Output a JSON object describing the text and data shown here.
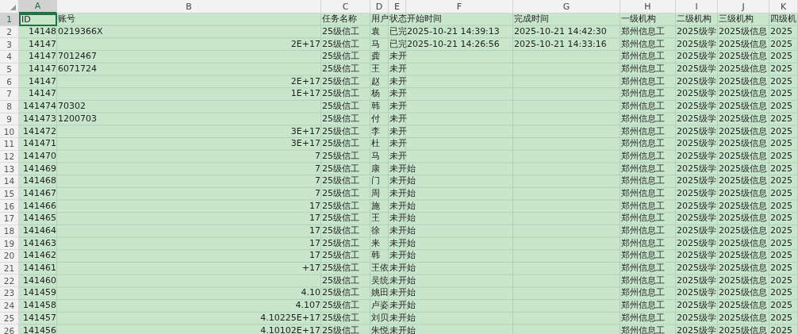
{
  "columns": [
    {
      "letter": "A",
      "selected": true
    },
    {
      "letter": "B",
      "selected": false
    },
    {
      "letter": "C",
      "selected": false
    },
    {
      "letter": "D",
      "selected": false
    },
    {
      "letter": "E",
      "selected": false
    },
    {
      "letter": "F",
      "selected": false
    },
    {
      "letter": "G",
      "selected": false
    },
    {
      "letter": "H",
      "selected": false
    },
    {
      "letter": "I",
      "selected": false
    },
    {
      "letter": "J",
      "selected": false
    },
    {
      "letter": "K",
      "selected": false
    }
  ],
  "rows": [
    {
      "number": "1",
      "selected": true,
      "cells": {
        "A": "ID",
        "B": {
          "text": "账号",
          "kind": "text"
        },
        "C": "任务名称",
        "D": "用户",
        "E": "状态",
        "F": "开始时间",
        "G": "完成时间",
        "H": "一级机构",
        "I": "二级机构",
        "J": "三级机构",
        "K": "四级机"
      }
    },
    {
      "number": "2",
      "selected": false,
      "cells": {
        "A": "14148",
        "B": {
          "text": "0219366X",
          "kind": "text"
        },
        "C": "25级信工",
        "D": "袁",
        "E": "已完",
        "F": "2025-10-21 14:39:13",
        "G": "2025-10-21 14:42:30",
        "H": "郑州信息工",
        "I": "2025级学",
        "J": "2025级信息",
        "K": "2025"
      }
    },
    {
      "number": "3",
      "selected": false,
      "cells": {
        "A": "14147",
        "B": {
          "text": "2E+17",
          "kind": "number"
        },
        "C": "25级信工",
        "D": "马",
        "E": "已完",
        "F": "2025-10-21 14:26:56",
        "G": "2025-10-21 14:33:16",
        "H": "郑州信息工",
        "I": "2025级学",
        "J": "2025级信息",
        "K": "2025"
      }
    },
    {
      "number": "4",
      "selected": false,
      "cells": {
        "A": "14147",
        "B": {
          "text": "7012467",
          "kind": "text"
        },
        "C": "25级信工",
        "D": "龚",
        "E": "未开",
        "H": "郑州信息工",
        "I": "2025级学",
        "J": "2025级信息",
        "K": "2025"
      }
    },
    {
      "number": "5",
      "selected": false,
      "cells": {
        "A": "14147",
        "B": {
          "text": "6071724",
          "kind": "text"
        },
        "C": "25级信工",
        "D": "王",
        "E": "未开",
        "H": "郑州信息工",
        "I": "2025级学",
        "J": "2025级信息",
        "K": "2025"
      }
    },
    {
      "number": "6",
      "selected": false,
      "cells": {
        "A": "14147",
        "B": {
          "text": "2E+17",
          "kind": "number"
        },
        "C": "25级信工",
        "D": "赵",
        "E": "未开",
        "H": "郑州信息工",
        "I": "2025级学",
        "J": "2025级信息",
        "K": "2025"
      }
    },
    {
      "number": "7",
      "selected": false,
      "cells": {
        "A": "14147",
        "B": {
          "text": "1E+17",
          "kind": "number"
        },
        "C": "25级信工",
        "D": "杨",
        "E": "未开",
        "H": "郑州信息工",
        "I": "2025级学",
        "J": "2025级信息",
        "K": "2025"
      }
    },
    {
      "number": "8",
      "selected": false,
      "cells": {
        "A": "141474",
        "B": {
          "text": "70302",
          "kind": "text"
        },
        "C": "25级信工",
        "D": "韩",
        "E": "未开",
        "H": "郑州信息工",
        "I": "2025级学",
        "J": "2025级信息",
        "K": "2025"
      }
    },
    {
      "number": "9",
      "selected": false,
      "cells": {
        "A": "141473",
        "B": {
          "text": "1200703",
          "kind": "text"
        },
        "C": "25级信工",
        "D": "付",
        "E": "未开",
        "H": "郑州信息工",
        "I": "2025级学",
        "J": "2025级信息",
        "K": "2025"
      }
    },
    {
      "number": "10",
      "selected": false,
      "cells": {
        "A": "141472",
        "B": {
          "text": "3E+17",
          "kind": "number"
        },
        "C": "25级信工",
        "D": "李",
        "E": "未开",
        "H": "郑州信息工",
        "I": "2025级学",
        "J": "2025级信息",
        "K": "2025"
      }
    },
    {
      "number": "11",
      "selected": false,
      "cells": {
        "A": "141471",
        "B": {
          "text": "3E+17",
          "kind": "number"
        },
        "C": "25级信工",
        "D": "杜",
        "E": "未开",
        "H": "郑州信息工",
        "I": "2025级学",
        "J": "2025级信息",
        "K": "2025"
      }
    },
    {
      "number": "12",
      "selected": false,
      "cells": {
        "A": "141470",
        "B": {
          "text": "7",
          "kind": "number"
        },
        "C": "25级信工",
        "D": "马",
        "E": "未开",
        "H": "郑州信息工",
        "I": "2025级学",
        "J": "2025级信息",
        "K": "2025"
      }
    },
    {
      "number": "13",
      "selected": false,
      "cells": {
        "A": "141469",
        "B": {
          "text": "7",
          "kind": "number"
        },
        "C": "25级信工",
        "D": "康",
        "E": "未开始",
        "H": "郑州信息工",
        "I": "2025级学",
        "J": "2025级信息",
        "K": "2025"
      }
    },
    {
      "number": "14",
      "selected": false,
      "cells": {
        "A": "141468",
        "B": {
          "text": "7",
          "kind": "number"
        },
        "C": "25级信工",
        "D": "门",
        "E": "未开始",
        "H": "郑州信息工",
        "I": "2025级学",
        "J": "2025级信息",
        "K": "2025"
      }
    },
    {
      "number": "15",
      "selected": false,
      "cells": {
        "A": "141467",
        "B": {
          "text": "7",
          "kind": "number"
        },
        "C": "25级信工",
        "D": "周",
        "E": "未开始",
        "H": "郑州信息工",
        "I": "2025级学",
        "J": "2025级信息",
        "K": "2025"
      }
    },
    {
      "number": "16",
      "selected": false,
      "cells": {
        "A": "141466",
        "B": {
          "text": "17",
          "kind": "number"
        },
        "C": "25级信工",
        "D": "施",
        "E": "未开始",
        "H": "郑州信息工",
        "I": "2025级学",
        "J": "2025级信息",
        "K": "2025"
      }
    },
    {
      "number": "17",
      "selected": false,
      "cells": {
        "A": "141465",
        "B": {
          "text": "17",
          "kind": "number"
        },
        "C": "25级信工",
        "D": "王",
        "E": "未开始",
        "H": "郑州信息工",
        "I": "2025级学",
        "J": "2025级信息",
        "K": "2025"
      }
    },
    {
      "number": "18",
      "selected": false,
      "cells": {
        "A": "141464",
        "B": {
          "text": "17",
          "kind": "number"
        },
        "C": "25级信工",
        "D": "徐",
        "E": "未开始",
        "H": "郑州信息工",
        "I": "2025级学",
        "J": "2025级信息",
        "K": "2025"
      }
    },
    {
      "number": "19",
      "selected": false,
      "cells": {
        "A": "141463",
        "B": {
          "text": "17",
          "kind": "number"
        },
        "C": "25级信工",
        "D": "来",
        "E": "未开始",
        "H": "郑州信息工",
        "I": "2025级学",
        "J": "2025级信息",
        "K": "2025"
      }
    },
    {
      "number": "20",
      "selected": false,
      "cells": {
        "A": "141462",
        "B": {
          "text": "17",
          "kind": "number"
        },
        "C": "25级信工",
        "D": "韩",
        "E": "未开始",
        "H": "郑州信息工",
        "I": "2025级学",
        "J": "2025级信息",
        "K": "2025"
      }
    },
    {
      "number": "21",
      "selected": false,
      "cells": {
        "A": "141461",
        "B": {
          "text": "+17",
          "kind": "number"
        },
        "C": "25级信工",
        "D": "王依",
        "E": "未开始",
        "H": "郑州信息工",
        "I": "2025级学",
        "J": "2025级信息",
        "K": "2025"
      }
    },
    {
      "number": "22",
      "selected": false,
      "cells": {
        "A": "141460",
        "C": "25级信工",
        "D": "吴统",
        "E": "未开始",
        "H": "郑州信息工",
        "I": "2025级学",
        "J": "2025级信息",
        "K": "2025"
      }
    },
    {
      "number": "23",
      "selected": false,
      "cells": {
        "A": "141459",
        "B": {
          "text": "4.10",
          "kind": "number"
        },
        "C": "25级信工",
        "D": "姚田",
        "E": "未开始",
        "H": "郑州信息工",
        "I": "2025级学",
        "J": "2025级信息",
        "K": "2025"
      }
    },
    {
      "number": "24",
      "selected": false,
      "cells": {
        "A": "141458",
        "B": {
          "text": "4.107",
          "kind": "number"
        },
        "C": "25级信工",
        "D": "卢姿",
        "E": "未开始",
        "H": "郑州信息工",
        "I": "2025级学",
        "J": "2025级信息",
        "K": "2025"
      }
    },
    {
      "number": "25",
      "selected": false,
      "cells": {
        "A": "141457",
        "B": {
          "text": "4.10225E+17",
          "kind": "number"
        },
        "C": "25级信工",
        "D": "刘贝",
        "E": "未开始",
        "H": "郑州信息工",
        "I": "2025级学",
        "J": "2025级信息",
        "K": "2025"
      }
    },
    {
      "number": "26",
      "selected": false,
      "cells": {
        "A": "141456",
        "B": {
          "text": "4.10102E+17",
          "kind": "number"
        },
        "C": "25级信工",
        "D": "朱悦",
        "E": "未开始",
        "H": "郑州信息工",
        "I": "2025级学",
        "J": "2025级信息",
        "K": "2025"
      }
    }
  ]
}
